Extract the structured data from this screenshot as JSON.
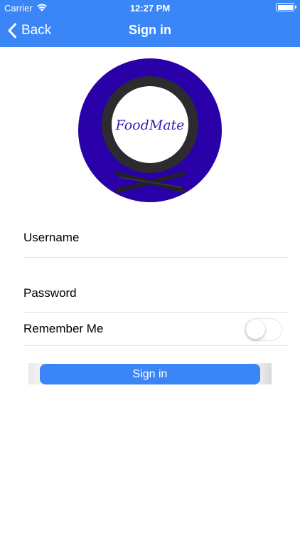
{
  "status_bar": {
    "carrier": "Carrier",
    "time": "12:27 PM"
  },
  "nav": {
    "back_label": "Back",
    "title": "Sign in"
  },
  "logo": {
    "text": "FoodMate",
    "colors": {
      "outer": "#2a00a8",
      "ring": "#2b2b30",
      "text": "#3d1bb5"
    }
  },
  "form": {
    "username_placeholder": "Username",
    "password_placeholder": "Password",
    "remember_label": "Remember Me",
    "remember_on": false,
    "submit_label": "Sign in"
  },
  "colors": {
    "accent": "#3b86f7"
  }
}
